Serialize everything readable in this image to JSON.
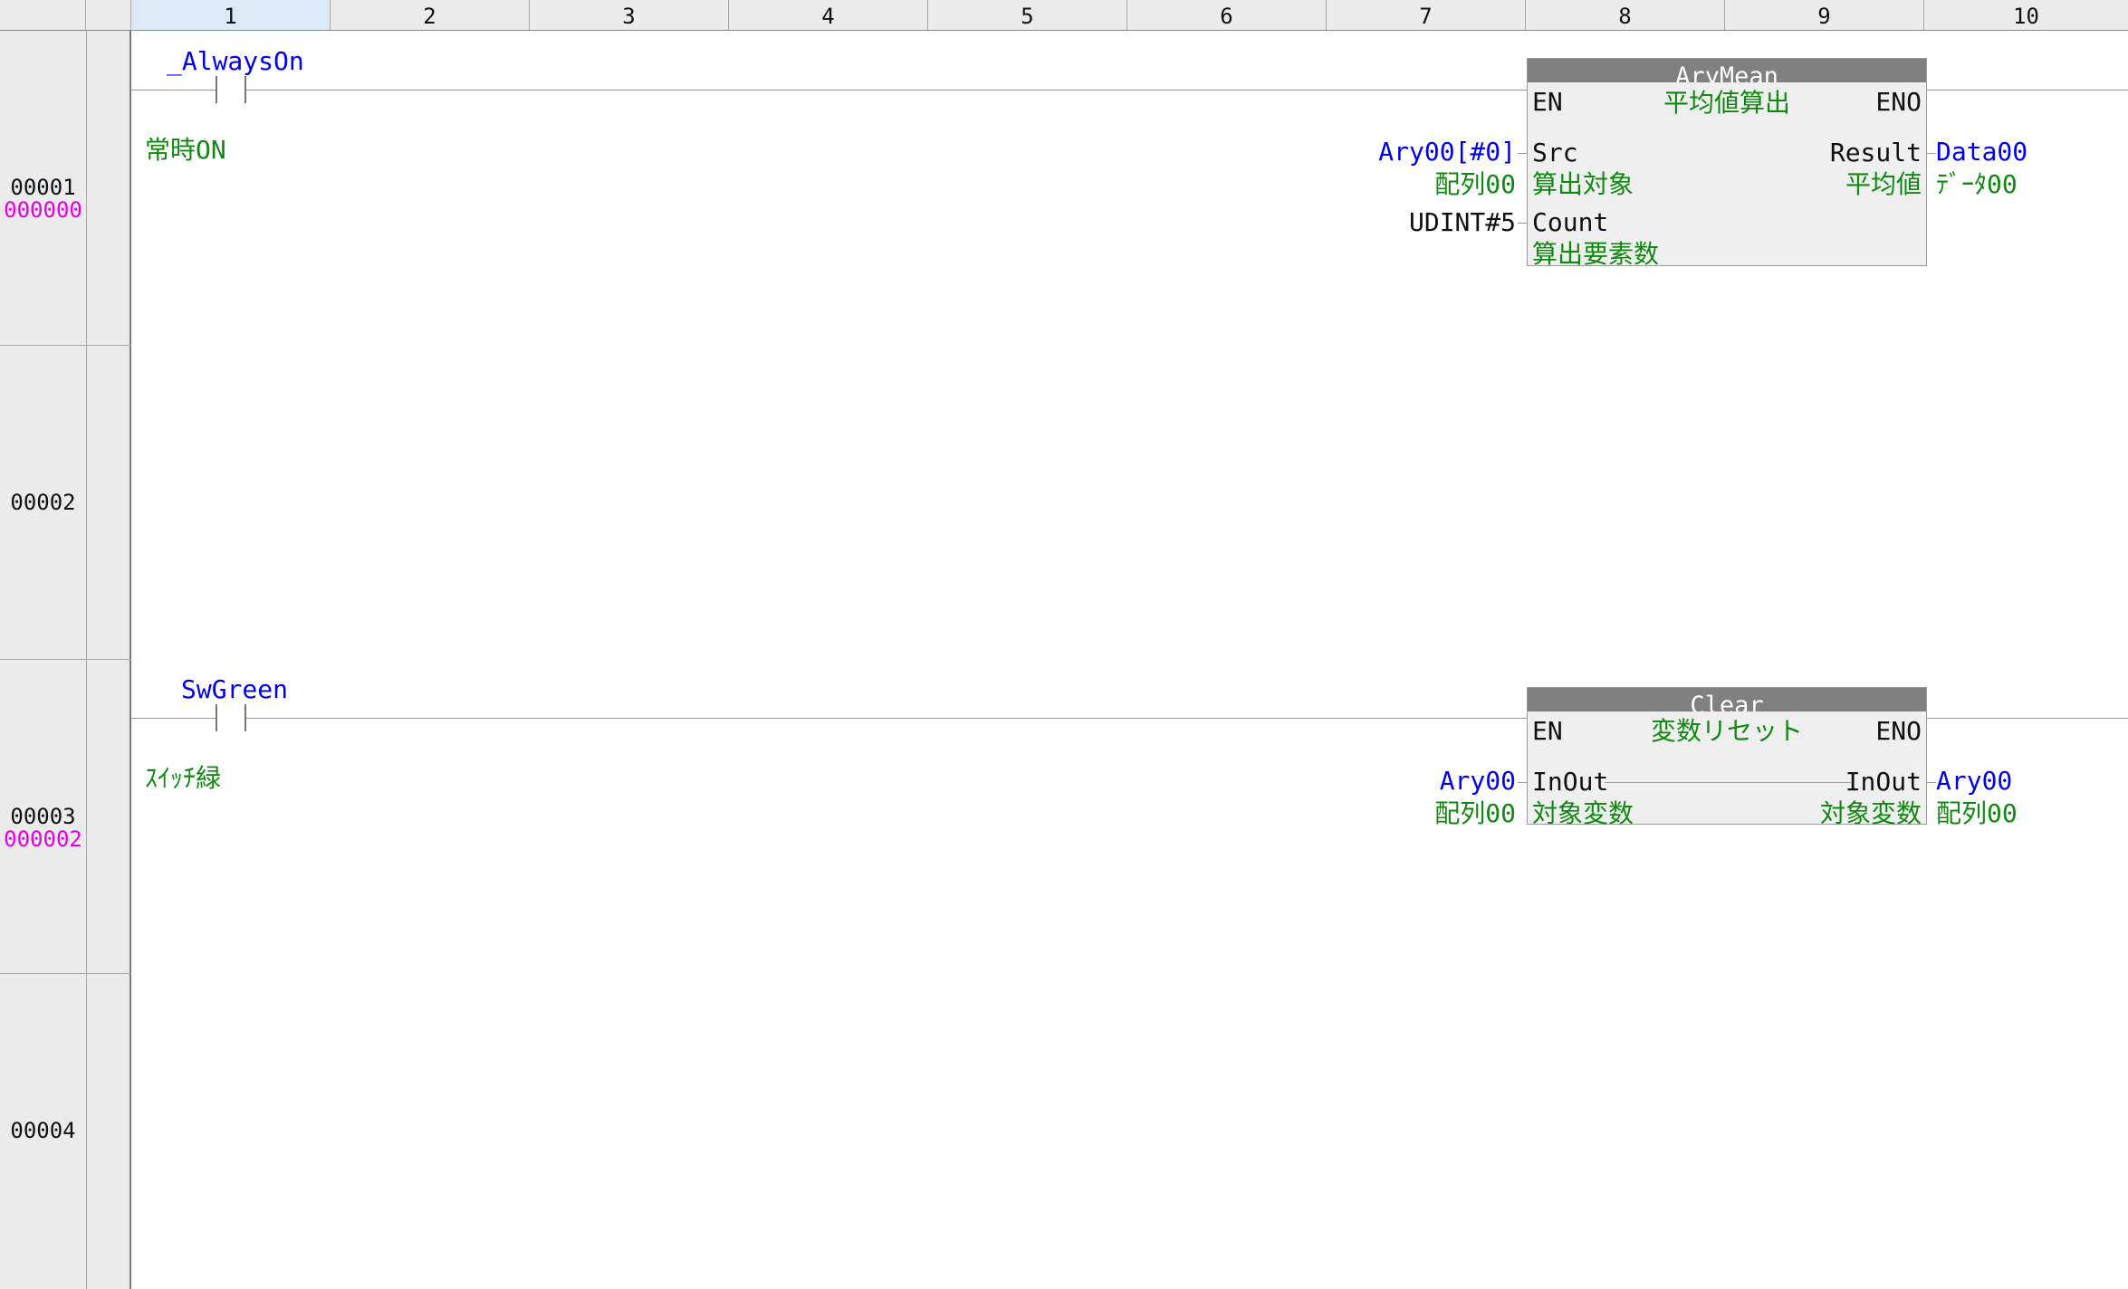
{
  "columns": [
    "1",
    "2",
    "3",
    "4",
    "5",
    "6",
    "7",
    "8",
    "9",
    "10"
  ],
  "rows": [
    {
      "number": "00001",
      "step": "000000"
    },
    {
      "number": "00002",
      "step": ""
    },
    {
      "number": "00003",
      "step": "000002"
    },
    {
      "number": "00004",
      "step": ""
    }
  ],
  "rung1": {
    "contact_variable": "_AlwaysOn",
    "contact_comment": "常時ON",
    "block": {
      "name": "AryMean",
      "comment": "平均値算出",
      "en": "EN",
      "eno": "ENO",
      "src_label": "Src",
      "src_comment": "算出対象",
      "count_label": "Count",
      "count_comment": "算出要素数",
      "result_label": "Result",
      "result_comment": "平均値"
    },
    "src_variable": "Ary00[#0]",
    "src_var_comment": "配列00",
    "count_value": "UDINT#5",
    "result_variable": "Data00",
    "result_var_comment": "ﾃﾞｰﾀ00"
  },
  "rung3": {
    "contact_variable": "SwGreen",
    "contact_comment": "ｽｲｯﾁ緑",
    "block": {
      "name": "Clear",
      "comment": "変数リセット",
      "en": "EN",
      "eno": "ENO",
      "inout_label": "InOut",
      "inout_comment": "対象変数"
    },
    "in_variable": "Ary00",
    "in_var_comment": "配列00",
    "out_variable": "Ary00",
    "out_var_comment": "配列00"
  },
  "colors": {
    "variable": "#0000ee",
    "comment": "#118811",
    "step": "#e600e6",
    "header": "#ebebeb",
    "block_title": "#808080"
  }
}
